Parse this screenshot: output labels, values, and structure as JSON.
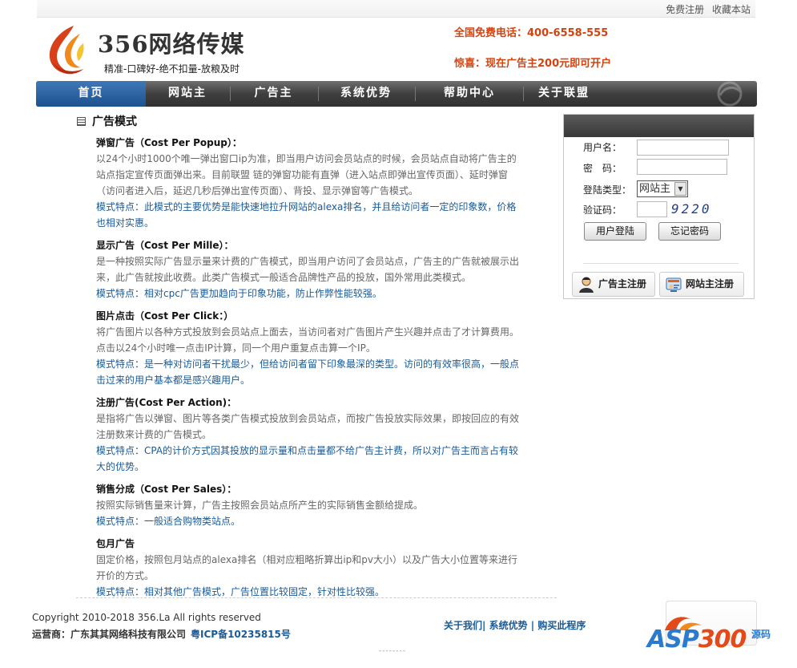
{
  "toplinks": {
    "register": "免费注册",
    "favorite": "收藏本站"
  },
  "header": {
    "logo_title": "356网络传媒",
    "logo_sub": "精准-口碑好-绝不扣量-放粮及时",
    "hotline": "全国免费电话：400-6558-555",
    "promo": "惊喜：现在广告主200元即可开户"
  },
  "nav": [
    "首页",
    "网站主",
    "广告主",
    "系统优势",
    "帮助中心",
    "关于联盟"
  ],
  "main": {
    "title": "广告模式",
    "blocks": [
      {
        "title": "弹窗广告（Cost Per Popup）：",
        "desc": "以24个小时1000个唯一弹出窗口ip为准，即当用户访问会员站点的时候，会员站点自动将广告主的站点指定宣传页面弹出来。目前联盟 链的弹窗功能有直弹（进入站点即弹出宣传页面）、延时弹窗（访问者进入后，延迟几秒后弹出宣传页面）、背投、显示弹窗等广告模式。",
        "feature": "模式特点：此模式的主要优势是能快速地拉升网站的alexa排名，并且给访问者一定的印象数，价格也相对实惠。"
      },
      {
        "title": "显示广告（Cost Per Mille）：",
        "desc": "是一种按照实际广告显示量来计费的广告模式，即当用户访问了会员站点，广告主的广告就被展示出来，此广告就按此收费。此类广告模式一般适合品牌性产品的投放，国外常用此类模式。",
        "feature": "模式特点：相对cpc广告更加趋向于印象功能，防止作弊性能较强。"
      },
      {
        "title": "图片点击（Cost Per Click：）",
        "desc": "将广告图片以各种方式投放到会员站点上面去，当访问者对广告图片产生兴趣并点击了才计算费用。点击以24个小时唯一点击IP计算，同一个用户重复点击算一个IP。",
        "feature": "模式特点：是一种对访问者干扰最少，但给访问者留下印象最深的类型。访问的有效率很高，一般点击过来的用户基本都是感兴趣用户。"
      },
      {
        "title": "注册广告(Cost Per Action)：",
        "desc": "是指将广告以弹窗、图片等各类广告模式投放到会员站点，而按广告投放实际效果，即按回应的有效注册数来计费的广告模式。",
        "feature": "模式特点：CPA的计价方式因其投放的显示量和点击量都不给广告主计费，所以对广告主而言占有较大的优势。"
      },
      {
        "title": "销售分成（Cost Per Sales）：",
        "desc": "按照实际销售量来计算，广告主按照会员站点所产生的实际销售金额给提成。",
        "feature": "模式特点：一般适合购物类站点。"
      },
      {
        "title": "包月广告",
        "desc": "固定价格，按照包月站点的alexa排名（相对应粗略折算出ip和pv大小）以及广告大小位置等来进行开价的方式。",
        "feature": "模式特点：相对其他广告模式，广告位置比较固定，针对性比较强。"
      }
    ]
  },
  "login": {
    "username_label": "用户名：",
    "password_label": "密　码：",
    "type_label": "登陆类型：",
    "type_value": "网站主",
    "captcha_label": "验证码：",
    "captcha_value": "9220",
    "login_button": "用户登陆",
    "forgot_button": "忘记密码",
    "advertiser_register": "广告主注册",
    "webmaster_register": "网站主注册"
  },
  "footer": {
    "copyright": "Copyright 2010-2018 356.La All rights reserved",
    "operator": "运营商：广东其其网络科技有限公司",
    "icp": "粤ICP备10235815号",
    "links": [
      "关于我们",
      "系统优势",
      "购买此程序"
    ],
    "watermark_a": "ASP",
    "watermark_b": "300",
    "watermark_sub": "源码"
  },
  "colors": {
    "accent_orange": "#d4430f",
    "link_blue": "#1a5a96",
    "nav_active": "#1d518f"
  }
}
